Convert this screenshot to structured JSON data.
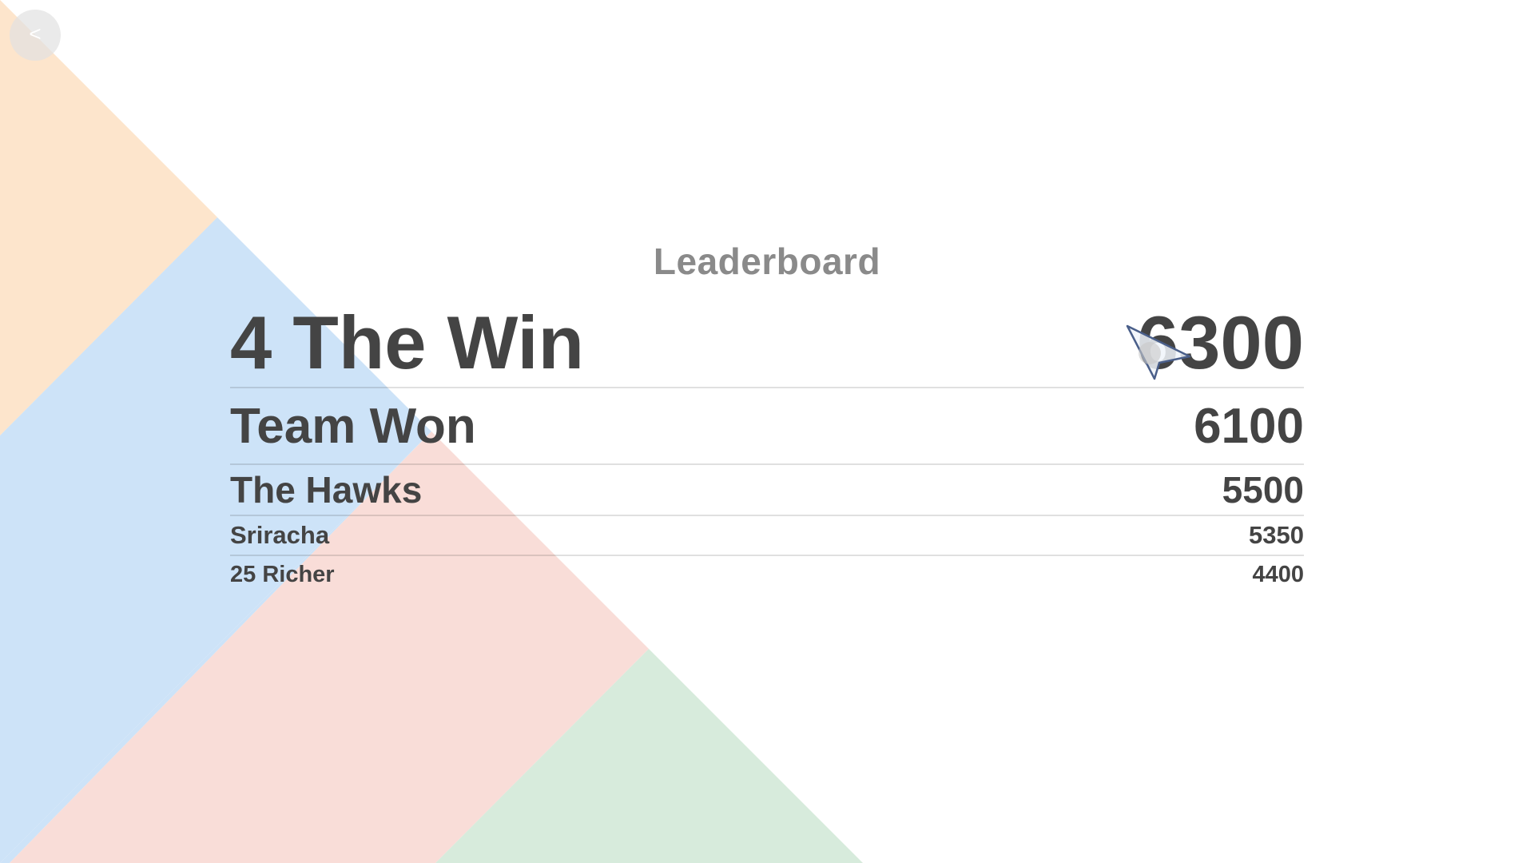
{
  "nav": {
    "back_label": "<"
  },
  "leaderboard": {
    "title": "Leaderboard",
    "entries": [
      {
        "team": "4 The Win",
        "score": "6300"
      },
      {
        "team": "Team Won",
        "score": "6100"
      },
      {
        "team": "The Hawks",
        "score": "5500"
      },
      {
        "team": "Sriracha",
        "score": "5350"
      },
      {
        "team": "25 Richer",
        "score": "4400"
      }
    ]
  },
  "colors": {
    "peach": "#fde5cc",
    "blue": "#cde3f8",
    "pink": "#f9ddd8",
    "green": "#d7ebdc",
    "title_gray": "#8a8a8a",
    "text_dark": "#444444"
  }
}
